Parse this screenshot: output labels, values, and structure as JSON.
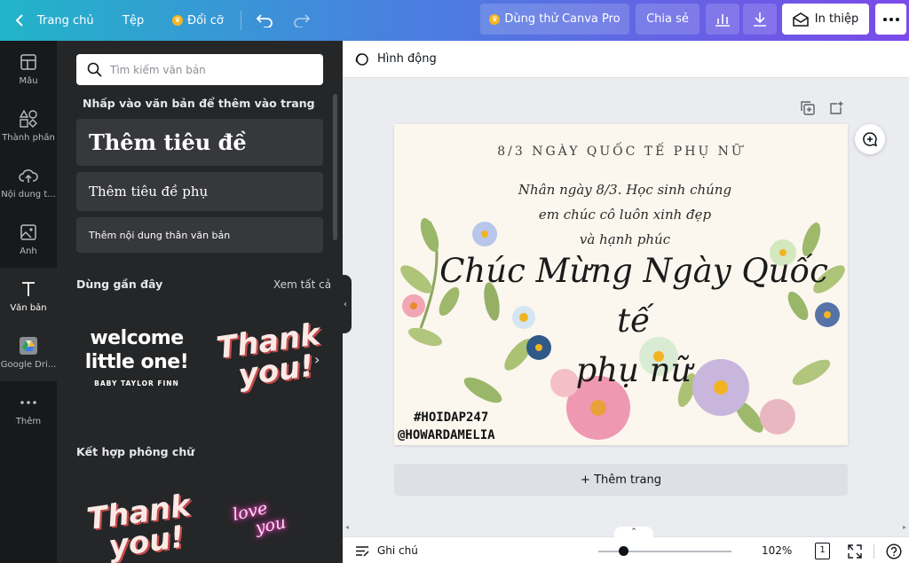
{
  "topbar": {
    "home_label": "Trang chủ",
    "file_label": "Tệp",
    "resize_label": "Đổi cỡ",
    "try_pro_label": "Dùng thử Canva Pro",
    "share_label": "Chia sẻ",
    "print_label": "In thiệp"
  },
  "rail": {
    "templates": "Mẫu",
    "elements": "Thành phần",
    "uploads": "Nội dung t...",
    "photos": "Ảnh",
    "text": "Văn bản",
    "drive": "Google Dri...",
    "more": "Thêm"
  },
  "panel": {
    "search_placeholder": "Tìm kiếm văn bản",
    "hint": "Nhấp vào văn bản để thêm vào trang",
    "add_heading": "Thêm tiêu đề",
    "add_subheading": "Thêm tiêu đề phụ",
    "add_body": "Thêm nội dung thân văn bản",
    "recent_title": "Dùng gần đây",
    "see_all": "Xem tất cả",
    "combos_title": "Kết hợp phông chữ",
    "previews": {
      "welcome_line1": "welcome",
      "welcome_line2": "little one!",
      "welcome_small": "BABY TAYLOR FINN",
      "thank1": "Thank",
      "you1": "you!",
      "thank2": "Thank",
      "you2": "you!",
      "love": "love",
      "you3": "you"
    }
  },
  "workspace": {
    "animate_label": "Hình động",
    "add_page_label": "+ Thêm trang",
    "notes_label": "Ghi chú",
    "zoom": "102%",
    "page_count": "1"
  },
  "design": {
    "title": "8/3 NGÀY QUỐC TẾ PHỤ NỮ",
    "msg_line1": "Nhân ngày 8/3. Học sinh chúng",
    "msg_line2": "em chúc cô luôn xinh đẹp",
    "msg_line3": "và hạnh phúc",
    "big_line1": "Chúc Mừng Ngày Quốc tế",
    "big_line2": "phụ nữ",
    "tag1": "#HOIDAP247",
    "tag2": "@HOWARDAMELIA"
  },
  "colors": {
    "brand_gradient_start": "#22b4c8",
    "brand_gradient_end": "#7b4ae8",
    "rail_bg": "#18191b",
    "panel_bg": "#252627",
    "canvas_bg": "#fbf6ee"
  }
}
